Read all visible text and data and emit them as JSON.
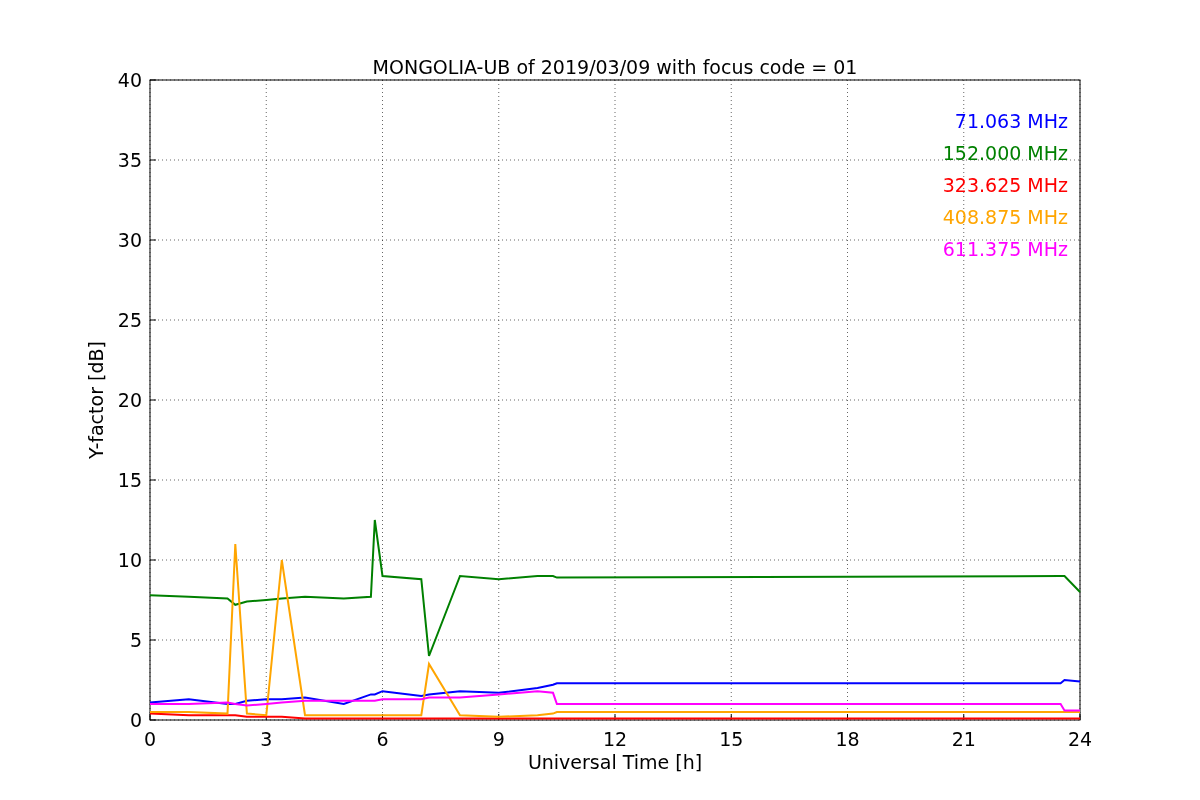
{
  "chart_data": {
    "type": "line",
    "title": "MONGOLIA-UB of 2019/03/09 with focus code = 01",
    "xlabel": "Universal Time [h]",
    "ylabel": "Y-factor [dB]",
    "x": [
      0,
      1,
      2,
      2.2,
      2.5,
      3,
      3.4,
      4,
      5,
      5.7,
      5.8,
      6,
      7,
      7.2,
      8,
      9,
      10,
      10.4,
      10.5,
      23.5,
      23.6,
      24
    ],
    "series": [
      {
        "name": "71.063 MHz",
        "color": "#0000ff",
        "values": [
          1.1,
          1.3,
          1.0,
          1.0,
          1.2,
          1.3,
          1.3,
          1.4,
          1.0,
          1.6,
          1.6,
          1.8,
          1.5,
          1.6,
          1.8,
          1.7,
          2.0,
          2.2,
          2.3,
          2.3,
          2.5,
          2.4
        ]
      },
      {
        "name": "152.000 MHz",
        "color": "#008000",
        "values": [
          7.8,
          7.7,
          7.6,
          7.2,
          7.4,
          7.5,
          7.6,
          7.7,
          7.6,
          7.7,
          12.5,
          9.0,
          8.8,
          4.0,
          9.0,
          8.8,
          9.0,
          9.0,
          8.9,
          9.0,
          9.0,
          8.0
        ]
      },
      {
        "name": "323.625 MHz",
        "color": "#ff0000",
        "values": [
          0.4,
          0.3,
          0.3,
          0.3,
          0.2,
          0.2,
          0.2,
          0.1,
          0.1,
          0.1,
          0.1,
          0.1,
          0.1,
          0.1,
          0.1,
          0.1,
          0.1,
          0.1,
          0.1,
          0.1,
          0.1,
          0.1
        ]
      },
      {
        "name": "408.875 MHz",
        "color": "#ffa500",
        "values": [
          0.5,
          0.5,
          0.4,
          11.0,
          0.4,
          0.3,
          10.0,
          0.3,
          0.3,
          0.3,
          0.3,
          0.3,
          0.3,
          3.5,
          0.3,
          0.2,
          0.3,
          0.4,
          0.5,
          0.5,
          0.5,
          0.5
        ]
      },
      {
        "name": "611.375 MHz",
        "color": "#ff00ff",
        "values": [
          1.0,
          1.0,
          1.1,
          1.0,
          0.9,
          1.0,
          1.1,
          1.2,
          1.2,
          1.2,
          1.2,
          1.3,
          1.3,
          1.4,
          1.4,
          1.6,
          1.8,
          1.7,
          1.0,
          1.0,
          0.6,
          0.6
        ]
      }
    ],
    "grid": true,
    "xlim": [
      0,
      24
    ],
    "ylim": [
      0,
      40
    ],
    "xticks": [
      0,
      3,
      6,
      9,
      12,
      15,
      18,
      21,
      24
    ],
    "yticks": [
      0,
      5,
      10,
      15,
      20,
      25,
      30,
      35,
      40
    ]
  }
}
